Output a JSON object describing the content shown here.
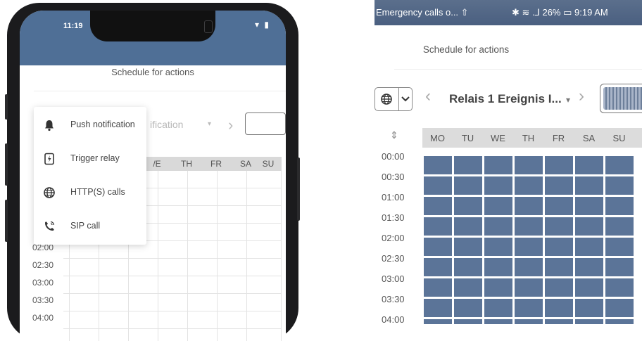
{
  "left_phone": {
    "status_time": "11:19",
    "status_icons": "▾ ▮",
    "title": "Schedule for actions",
    "dropdown_text": "ification",
    "dropdown_arrow": "▾",
    "next_arrow": "›",
    "days_partial": [
      "/E",
      "TH",
      "FR",
      "SA",
      "SU"
    ],
    "times": [
      "02:00",
      "02:30",
      "03:00",
      "03:30",
      "04:00"
    ],
    "menu": [
      {
        "label": "Push notification",
        "icon": "bell-icon"
      },
      {
        "label": "Trigger relay",
        "icon": "relay-icon"
      },
      {
        "label": "HTTP(S) calls",
        "icon": "globe-icon"
      },
      {
        "label": "SIP call",
        "icon": "phone-call-icon"
      }
    ]
  },
  "right_phone": {
    "status_left": "Emergency calls o... ⇧",
    "status_right": "✱ ≋ .⅃ 26% ▭ 9:19 AM",
    "title": "Schedule for actions",
    "dropdown_text": "Relais 1 Ereignis I...",
    "dropdown_arrow": "▾",
    "prev_arrow": "‹",
    "next_arrow": "›",
    "sort_icon": "⇕",
    "days": [
      "MO",
      "TU",
      "WE",
      "TH",
      "FR",
      "SA",
      "SU"
    ],
    "times": [
      "00:00",
      "00:30",
      "01:00",
      "01:30",
      "02:00",
      "02:30",
      "03:00",
      "03:30",
      "04:00"
    ]
  },
  "colors": {
    "accent": "#5b7498",
    "status_bar": "#4f6f96"
  }
}
